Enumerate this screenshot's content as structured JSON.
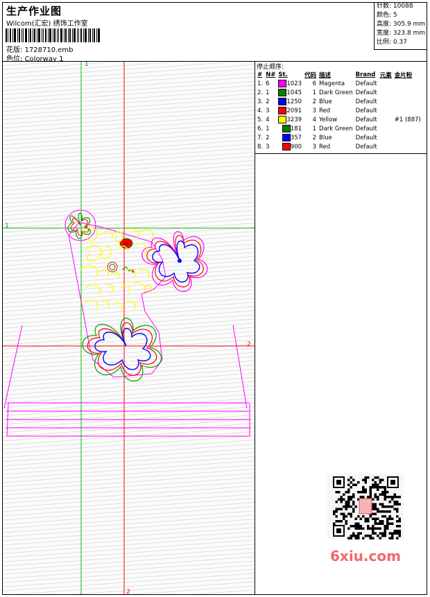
{
  "header": {
    "title": "生产作业图",
    "company": "Wilcom(汇宏) 绣饰工作室",
    "design_file_label": "花版:",
    "design_file": "1728710.emb",
    "colorway_label": "色位:",
    "colorway": "Colorway 1"
  },
  "stats": {
    "stitches_label": "针数:",
    "stitches": "10088",
    "colors_label": "颜色:",
    "colors": "5",
    "height_label": "高度:",
    "height": "305.9 mm",
    "width_label": "宽度:",
    "width": "323.8 mm",
    "scale_label": "比例:",
    "scale": "0.37"
  },
  "stop_sequence": {
    "title": "停止顺序:",
    "headers": [
      "#",
      "N#",
      "St.",
      "代码",
      "描述",
      "Brand",
      "元素",
      "金片粉"
    ],
    "rows": [
      {
        "idx": "1.",
        "n": "6",
        "color": "#ff00ff",
        "st": "1023",
        "code": "6",
        "desc": "Magenta",
        "brand": "Default",
        "element": "",
        "sequin": ""
      },
      {
        "idx": "2.",
        "n": "1",
        "color": "#008000",
        "st": "1045",
        "code": "1",
        "desc": "Dark Green",
        "brand": "Default",
        "element": "",
        "sequin": ""
      },
      {
        "idx": "3.",
        "n": "2",
        "color": "#0000ff",
        "st": "1250",
        "code": "2",
        "desc": "Blue",
        "brand": "Default",
        "element": "",
        "sequin": ""
      },
      {
        "idx": "4.",
        "n": "3",
        "color": "#ff0000",
        "st": "2091",
        "code": "3",
        "desc": "Red",
        "brand": "Default",
        "element": "",
        "sequin": ""
      },
      {
        "idx": "5.",
        "n": "4",
        "color": "#ffff00",
        "st": "3239",
        "code": "4",
        "desc": "Yellow",
        "brand": "Default",
        "element": "",
        "sequin": "#1 (887)"
      },
      {
        "idx": "6.",
        "n": "1",
        "color": "#008000",
        "st": "181",
        "code": "1",
        "desc": "Dark Green",
        "brand": "Default",
        "element": "",
        "sequin": ""
      },
      {
        "idx": "7.",
        "n": "2",
        "color": "#0000ff",
        "st": "357",
        "code": "2",
        "desc": "Blue",
        "brand": "Default",
        "element": "",
        "sequin": ""
      },
      {
        "idx": "8.",
        "n": "3",
        "color": "#ff0000",
        "st": "900",
        "code": "3",
        "desc": "Red",
        "brand": "Default",
        "element": "",
        "sequin": ""
      }
    ]
  },
  "guides": {
    "green_vertical": "1",
    "green_horizontal": "1",
    "red_vertical": "2",
    "red_horizontal": "2"
  },
  "watermark": "6xiu.com",
  "colors": {
    "magenta": "#ff00ff",
    "green": "#00c000",
    "red": "#ff0000",
    "blue": "#0000ff",
    "yellow": "#ffff00",
    "dark_green": "#008000"
  }
}
